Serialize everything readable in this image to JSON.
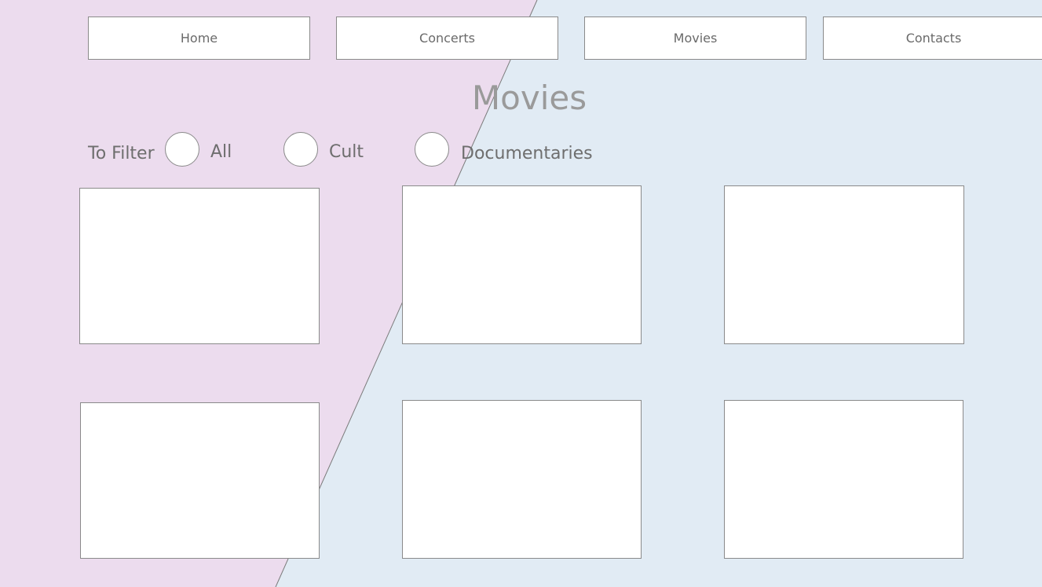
{
  "colors": {
    "left_panel": "#ecdcee",
    "right_panel": "#e1ebf4",
    "border": "#8a8a8a",
    "title": "#9a9a9a"
  },
  "nav": {
    "home": "Home",
    "concerts": "Concerts",
    "movies": "Movies",
    "contacts": "Contacts"
  },
  "page": {
    "title": "Movies"
  },
  "filter": {
    "label": "To Filter",
    "options": [
      "All",
      "Cult",
      "Documentaries"
    ]
  }
}
